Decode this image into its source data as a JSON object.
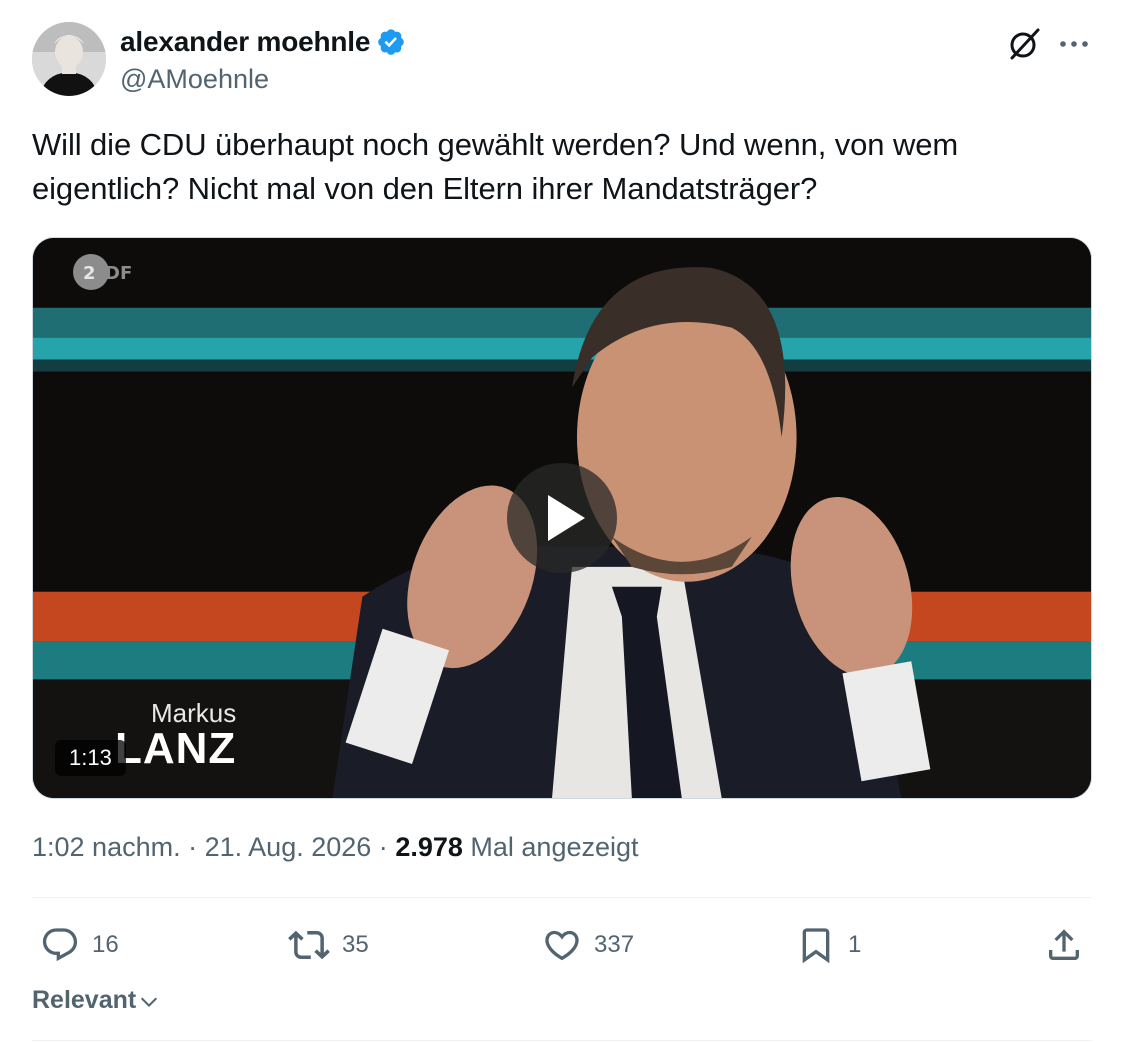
{
  "tweet": {
    "author": {
      "display_name": "alexander moehnle",
      "handle": "@AMoehnle",
      "verified": true
    },
    "text_line1": "Will die CDU überhaupt noch gewählt werden? Und wenn, von wem",
    "text_line2": "eigentlich? Nicht mal von den Eltern ihrer Mandatsträger?",
    "media": {
      "channel_logo": "ZDF",
      "show_title_small": "Markus",
      "show_title_large": "LANZ",
      "duration": "1:13"
    },
    "meta": {
      "time": "1:02 nachm.",
      "separator": "·",
      "date": "21. Aug. 2026",
      "views_count": "2.978",
      "views_label": "Mal angezeigt"
    },
    "actions": {
      "replies": "16",
      "reposts": "35",
      "likes": "337",
      "bookmarks": "1"
    },
    "sort_label": "Relevant"
  },
  "icons": {
    "verified": "verified-badge-icon",
    "grok": "grok-icon",
    "more": "more-icon",
    "reply": "reply-icon",
    "repost": "repost-icon",
    "like": "heart-icon",
    "bookmark": "bookmark-icon",
    "share": "share-icon",
    "play": "play-icon",
    "chevron": "chevron-down-icon"
  },
  "colors": {
    "accent": "#1d9bf0",
    "text_primary": "#0f1419",
    "text_secondary": "#536471"
  }
}
